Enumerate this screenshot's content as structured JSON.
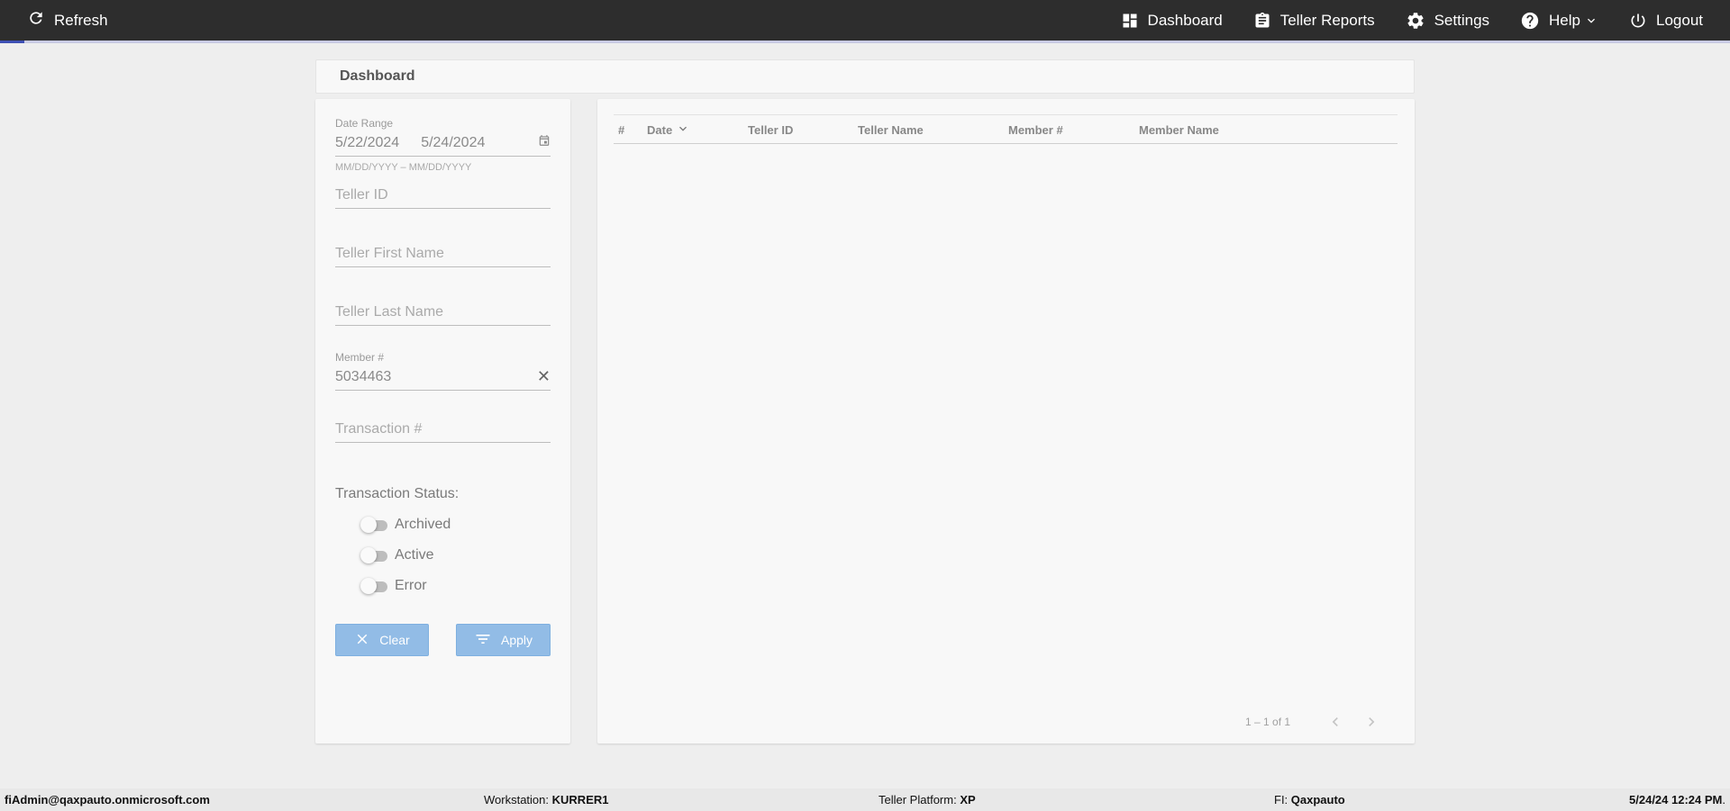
{
  "topbar": {
    "refresh_label": "Refresh",
    "nav": [
      {
        "label": "Dashboard",
        "icon": "dashboard-icon"
      },
      {
        "label": "Teller Reports",
        "icon": "clipboard-icon"
      },
      {
        "label": "Settings",
        "icon": "gear-icon"
      },
      {
        "label": "Help",
        "icon": "help-icon"
      },
      {
        "label": "Logout",
        "icon": "power-icon"
      }
    ],
    "progress_fraction": 0.014,
    "accent_color": "#3f51b5"
  },
  "page": {
    "title": "Dashboard"
  },
  "filters": {
    "date_range": {
      "label": "Date Range",
      "start": "5/22/2024",
      "end": "5/24/2024",
      "hint": "MM/DD/YYYY – MM/DD/YYYY"
    },
    "teller_id": {
      "placeholder": "Teller ID",
      "value": ""
    },
    "teller_first_name": {
      "placeholder": "Teller First Name",
      "value": ""
    },
    "teller_last_name": {
      "placeholder": "Teller Last Name",
      "value": ""
    },
    "member_number": {
      "label": "Member #",
      "value": "5034463"
    },
    "transaction_number": {
      "placeholder": "Transaction #",
      "value": ""
    },
    "status": {
      "title": "Transaction Status:",
      "options": [
        {
          "label": "Archived",
          "on": false
        },
        {
          "label": "Active",
          "on": false
        },
        {
          "label": "Error",
          "on": false
        }
      ]
    },
    "clear_label": "Clear",
    "apply_label": "Apply",
    "button_color": "#92bce6"
  },
  "table": {
    "columns": [
      "#",
      "Date",
      "Teller ID",
      "Teller Name",
      "Member #",
      "Member Name"
    ],
    "sorted_column": "Date",
    "rows": [],
    "pagination": {
      "range": "1 – 1 of 1"
    }
  },
  "footer": {
    "user": "fiAdmin@qaxpauto.onmicrosoft.com",
    "workstation_label": "Workstation:",
    "workstation": "KURRER1",
    "platform_label": "Teller Platform:",
    "platform": "XP",
    "fi_label": "FI:",
    "fi": "Qaxpauto",
    "datetime": "5/24/24 12:24 PM",
    "datetime_suffix": "."
  }
}
